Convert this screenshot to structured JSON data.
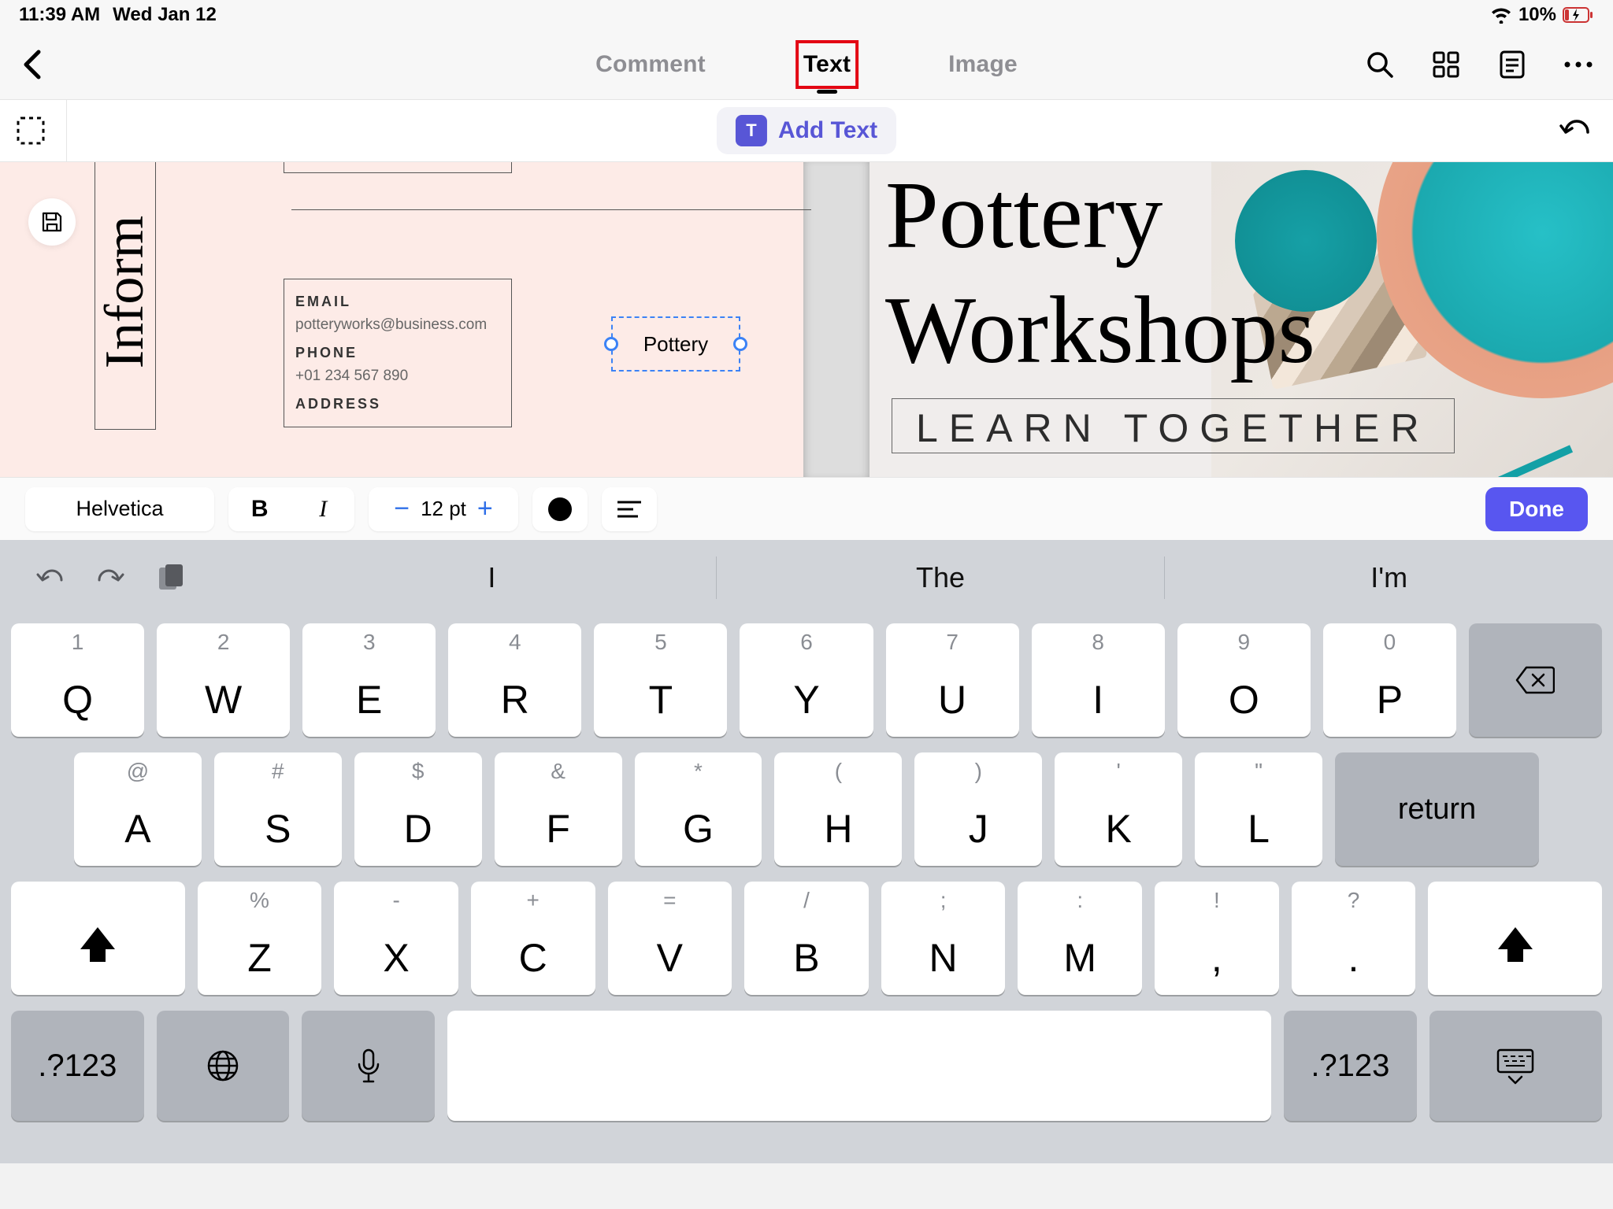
{
  "status": {
    "time": "11:39 AM",
    "date": "Wed Jan 12",
    "battery": "10%"
  },
  "tabs": {
    "comment": "Comment",
    "text": "Text",
    "image": "Image"
  },
  "toolbar": {
    "add_text": "Add Text"
  },
  "canvas": {
    "side_label": "Inform",
    "email_lbl": "EMAIL",
    "email_val": "potteryworks@business.com",
    "phone_lbl": "PHONE",
    "phone_val": "+01 234 567 890",
    "address_lbl": "ADDRESS",
    "inserted": "Pottery",
    "right_title1": "Pottery",
    "right_title2": "Workshops",
    "right_sub": "LEARN TOGETHER"
  },
  "fmt": {
    "font": "Helvetica",
    "size": "12 pt",
    "done": "Done"
  },
  "pred": {
    "s1": "I",
    "s2": "The",
    "s3": "I'm"
  },
  "keys": {
    "r1": [
      {
        "a": "1",
        "m": "Q"
      },
      {
        "a": "2",
        "m": "W"
      },
      {
        "a": "3",
        "m": "E"
      },
      {
        "a": "4",
        "m": "R"
      },
      {
        "a": "5",
        "m": "T"
      },
      {
        "a": "6",
        "m": "Y"
      },
      {
        "a": "7",
        "m": "U"
      },
      {
        "a": "8",
        "m": "I"
      },
      {
        "a": "9",
        "m": "O"
      },
      {
        "a": "0",
        "m": "P"
      }
    ],
    "r2": [
      {
        "a": "@",
        "m": "A"
      },
      {
        "a": "#",
        "m": "S"
      },
      {
        "a": "$",
        "m": "D"
      },
      {
        "a": "&",
        "m": "F"
      },
      {
        "a": "*",
        "m": "G"
      },
      {
        "a": "(",
        "m": "H"
      },
      {
        "a": ")",
        "m": "J"
      },
      {
        "a": "'",
        "m": "K"
      },
      {
        "a": "\"",
        "m": "L"
      }
    ],
    "r3": [
      {
        "a": "%",
        "m": "Z"
      },
      {
        "a": "-",
        "m": "X"
      },
      {
        "a": "+",
        "m": "C"
      },
      {
        "a": "=",
        "m": "V"
      },
      {
        "a": "/",
        "m": "B"
      },
      {
        "a": ";",
        "m": "N"
      },
      {
        "a": ":",
        "m": "M"
      },
      {
        "a": "!",
        "m": ","
      },
      {
        "a": "?",
        "m": "."
      }
    ],
    "return": "return",
    "num": ".?123"
  }
}
